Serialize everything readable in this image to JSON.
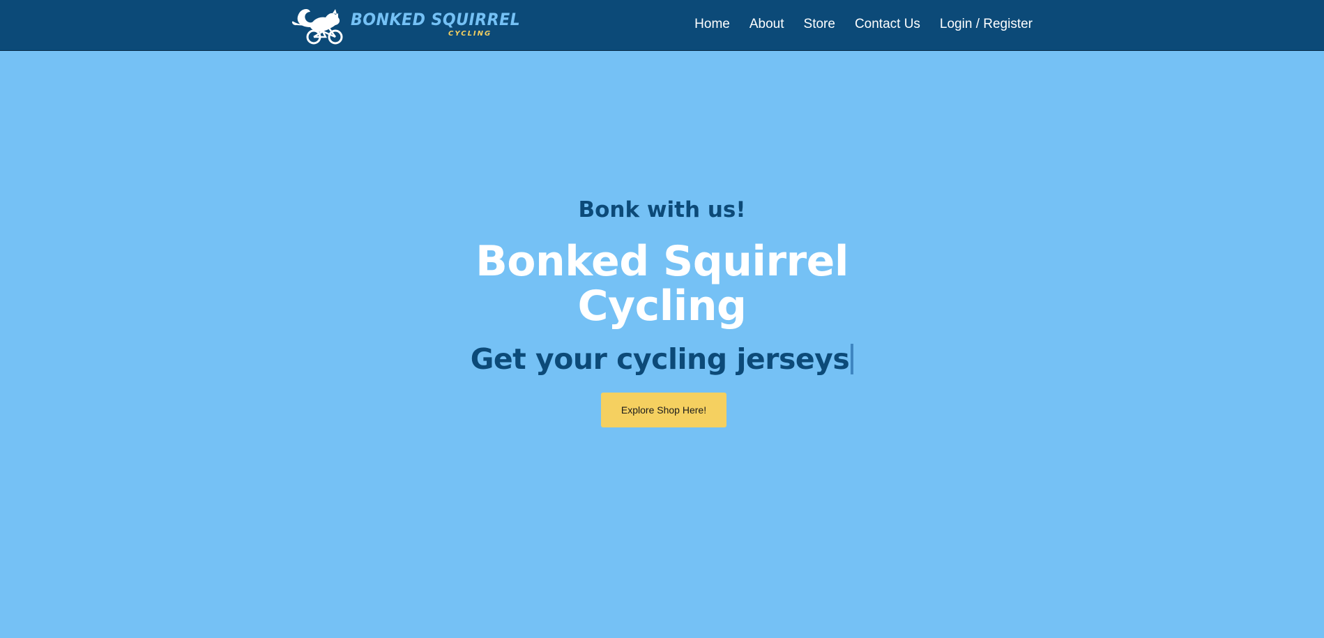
{
  "brand": {
    "name": "BONKED SQUIRREL",
    "sub": "CYCLING",
    "logo_icon": "squirrel-on-bicycle-icon"
  },
  "nav": {
    "items": [
      {
        "label": "Home"
      },
      {
        "label": "About"
      },
      {
        "label": "Store"
      },
      {
        "label": "Contact Us"
      },
      {
        "label": "Login / Register"
      }
    ]
  },
  "hero": {
    "tagline": "Bonk with us!",
    "title": "Bonked Squirrel Cycling",
    "typed_text": "Get your cycling jerseys",
    "cta_label": "Explore Shop Here!"
  },
  "colors": {
    "navbar_bg": "#0c4a78",
    "page_bg": "#75c1f5",
    "accent_yellow": "#f5d060",
    "dark_blue_text": "#0c4a78",
    "white": "#ffffff"
  }
}
